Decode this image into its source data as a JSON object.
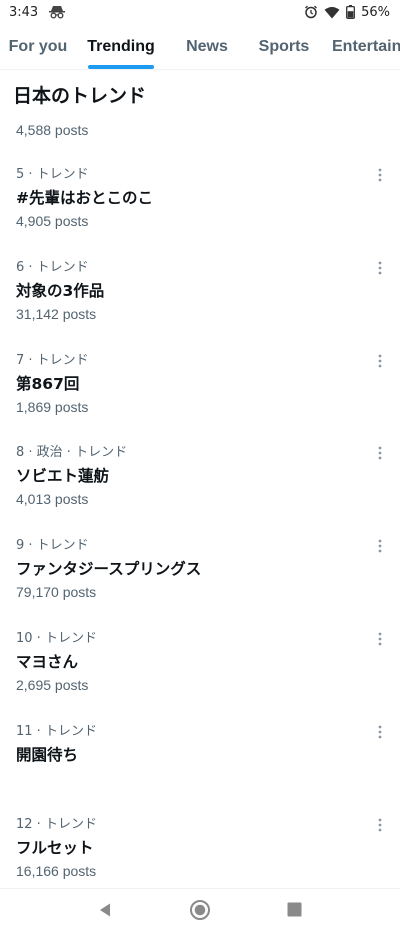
{
  "status_bar": {
    "time": "3:43",
    "battery": "56%",
    "icons": [
      "incognito-icon",
      "alarm-icon",
      "wifi-icon",
      "battery-icon"
    ]
  },
  "tabs": [
    {
      "label": "For you",
      "active": false
    },
    {
      "label": "Trending",
      "active": true
    },
    {
      "label": "News",
      "active": false
    },
    {
      "label": "Sports",
      "active": false
    },
    {
      "label": "Entertain",
      "active": false
    }
  ],
  "section": {
    "title": "日本のトレンド"
  },
  "partial_item": {
    "posts": "4,588 posts"
  },
  "trends": [
    {
      "meta": "5 · トレンド",
      "name": "#先輩はおとこのこ",
      "posts": "4,905 posts"
    },
    {
      "meta": "6 · トレンド",
      "name": "対象の3作品",
      "posts": "31,142 posts"
    },
    {
      "meta": "7 · トレンド",
      "name": "第867回",
      "posts": "1,869 posts"
    },
    {
      "meta": "8 · 政治 · トレンド",
      "name": "ソビエト蓮舫",
      "posts": "4,013 posts"
    },
    {
      "meta": "9 · トレンド",
      "name": "ファンタジースプリングス",
      "posts": "79,170 posts"
    },
    {
      "meta": "10 · トレンド",
      "name": "マヨさん",
      "posts": "2,695 posts"
    },
    {
      "meta": "11 · トレンド",
      "name": "開園待ち",
      "posts": ""
    },
    {
      "meta": "12 · トレンド",
      "name": "フルセット",
      "posts": "16,166 posts"
    }
  ],
  "colors": {
    "accent": "#1d9bf0",
    "text_primary": "#0f1419",
    "text_secondary": "#536471"
  },
  "nav": {
    "icons": [
      "back-icon",
      "home-icon",
      "recents-icon"
    ]
  }
}
